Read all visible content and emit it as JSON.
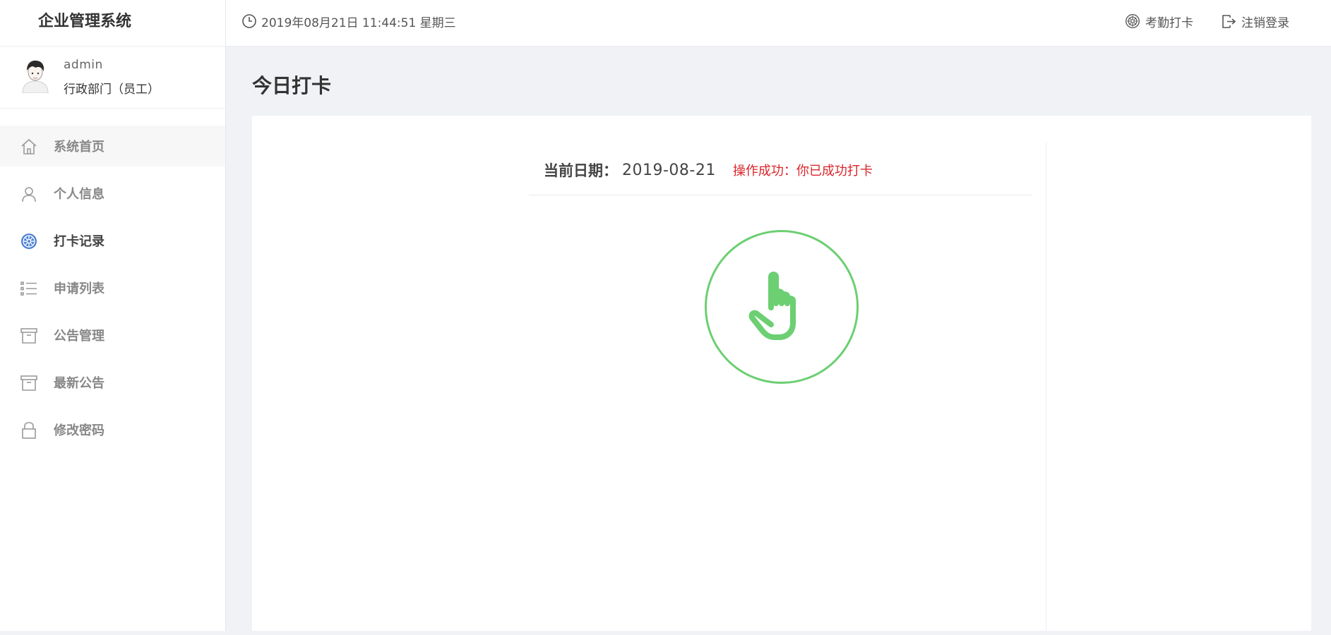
{
  "app": {
    "title": "企业管理系统"
  },
  "user": {
    "name": "admin",
    "dept": "行政部门（员工）"
  },
  "nav": {
    "items": [
      {
        "label": "系统首页",
        "icon": "home-icon"
      },
      {
        "label": "个人信息",
        "icon": "user-icon"
      },
      {
        "label": "打卡记录",
        "icon": "checkin-record-icon",
        "active": true
      },
      {
        "label": "申请列表",
        "icon": "list-icon"
      },
      {
        "label": "公告管理",
        "icon": "archive-icon"
      },
      {
        "label": "最新公告",
        "icon": "archive-icon"
      },
      {
        "label": "修改密码",
        "icon": "lock-icon"
      }
    ]
  },
  "topbar": {
    "datetime": "2019年08月21日 11:44:51 星期三",
    "checkin_label": "考勤打卡",
    "logout_label": "注销登录"
  },
  "page": {
    "title": "今日打卡",
    "date_label": "当前日期：",
    "date_value": "2019-08-21",
    "message": "操作成功：你已成功打卡"
  },
  "colors": {
    "accent_green": "#6ccf72",
    "message_red": "#d9262a",
    "active_icon_blue": "#4a7fd4"
  }
}
